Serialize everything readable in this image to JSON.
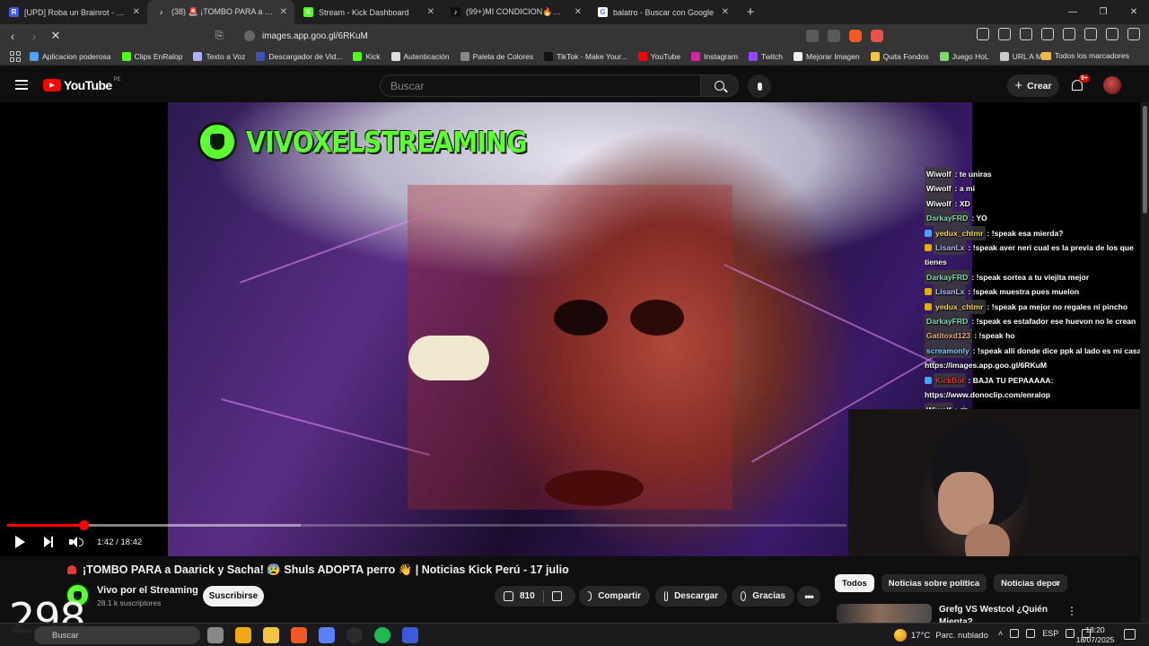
{
  "browser": {
    "tabs": [
      {
        "label": "[UPD] Roba un Brainrot - Roblox",
        "color": "#3b5bdb",
        "glyph": "R"
      },
      {
        "label": "(38) 🚨 ¡TOMBO PARA a Daarick",
        "color": "#353535",
        "glyph": "♪",
        "active": true
      },
      {
        "label": "Stream - Kick Dashboard",
        "color": "#53fc18",
        "glyph": "K"
      },
      {
        "label": "(99+)MI CONDICION🔥🔥 #fyp #",
        "color": "#111111",
        "glyph": "♪"
      },
      {
        "label": "balatro - Buscar con Google",
        "color": "#ffffff",
        "glyph": "G"
      }
    ],
    "url": "images.app.goo.gl/6RKuM",
    "bookmarks": [
      {
        "label": "Aplicacion poderosa",
        "color": "#4aa3ff"
      },
      {
        "label": "Clips EnRalop",
        "color": "#53fc18"
      },
      {
        "label": "Texto a Voz",
        "color": "#b0b0ff"
      },
      {
        "label": "Descargador de Vid...",
        "color": "#3f51b5"
      },
      {
        "label": "Kick",
        "color": "#53fc18"
      },
      {
        "label": "Autenticación",
        "color": "#dddddd"
      },
      {
        "label": "Paleta de Colores",
        "color": "#888888"
      },
      {
        "label": "TikTok - Make Your...",
        "color": "#111111"
      },
      {
        "label": "YouTube",
        "color": "#ff0000"
      },
      {
        "label": "Instagram",
        "color": "#d6249f"
      },
      {
        "label": "Twitch",
        "color": "#9146ff"
      },
      {
        "label": "Mejorar Imagen",
        "color": "#eeeeee"
      },
      {
        "label": "Quita Fondos",
        "color": "#f5c542"
      },
      {
        "label": "Juego HoL",
        "color": "#7bd86b"
      },
      {
        "label": "URL A MP3",
        "color": "#cccccc"
      }
    ],
    "all_bookmarks": "Todos los marcadores"
  },
  "youtube": {
    "logo_word": "YouTube",
    "country": "PE",
    "search_placeholder": "Buscar",
    "create_label": "Crear",
    "notif_count": "9+"
  },
  "video": {
    "watermark": "VIVOXELSTREAMING",
    "current_time": "1:42",
    "duration": "18:42",
    "time_display": "1:42 / 18:42",
    "progress_fraction": 0.0909,
    "buffer_fraction": 0.35
  },
  "chat": [
    {
      "user": "Wiwolf",
      "user_color": "#ffffff",
      "badge": null,
      "text": ": te uniras"
    },
    {
      "user": "Wiwolf",
      "user_color": "#ffffff",
      "badge": null,
      "text": ": a mi"
    },
    {
      "user": "Wiwolf",
      "user_color": "#ffffff",
      "badge": null,
      "text": ": XD"
    },
    {
      "user": "DarkayFRD",
      "user_color": "#7be3b0",
      "badge": null,
      "text": ": YO"
    },
    {
      "user": "yedux_chtmr",
      "user_color": "#f5d742",
      "badge": "#4aa3ff",
      "text": ": !speak esa mierda?"
    },
    {
      "user": "LisanLx",
      "user_color": "#b7b7ff",
      "badge": "#e0b000",
      "text": ": !speak aver neri cual es la previa de los que tienes"
    },
    {
      "user": "DarkayFRD",
      "user_color": "#7be3b0",
      "badge": null,
      "text": ": !speak sortea a tu viejita mejor"
    },
    {
      "user": "LisanLx",
      "user_color": "#b7b7ff",
      "badge": "#e0b000",
      "text": ": !speak muestra pues muelon"
    },
    {
      "user": "yedux_chtmr",
      "user_color": "#f5d742",
      "badge": "#e0b000",
      "text": ": !speak pa mejor no regales ni pincho"
    },
    {
      "user": "DarkayFRD",
      "user_color": "#7be3b0",
      "badge": null,
      "text": ": !speak es estafador ese huevon no le crean"
    },
    {
      "user": "Gatitoxd123",
      "user_color": "#f0b070",
      "badge": null,
      "text": ": !speak ho"
    },
    {
      "user": "screamonly",
      "user_color": "#7fd0ff",
      "badge": null,
      "text": ": !speak allí donde dice ppk al lado es mi casa https://images.app.goo.gl/6RKuM"
    },
    {
      "user": "KickBot",
      "user_color": "#e53935",
      "badge": "#4aa3ff",
      "text": ": BAJA TU PEPAAAAA: https://www.donoclip.com/enralop"
    },
    {
      "user": "Wiwolf",
      "user_color": "#ffffff",
      "badge": null,
      "text": ": 🤖"
    }
  ],
  "details": {
    "title": "¡TOMBO PARA a Daarick y Sacha! 😰 Shuls ADOPTA perro 👋 | Noticias Kick Perú - 17 julio",
    "channel_name": "Vivo por el Streaming",
    "subscribers": "28.1 k suscriptores",
    "subscribe_label": "Suscribirse",
    "likes": "810",
    "share_label": "Compartir",
    "download_label": "Descargar",
    "thanks_label": "Gracias"
  },
  "sidebar": {
    "chips": [
      {
        "label": "Todos",
        "active": true
      },
      {
        "label": "Noticias sobre política",
        "active": false
      },
      {
        "label": "Noticias depor",
        "active": false
      }
    ],
    "rec_title": "Grefg VS Westcol ¿Quién Mienta?"
  },
  "overlay_counter": "298",
  "taskbar": {
    "search_label": "Buscar",
    "temperature": "17°C",
    "weather_text": "Parc. nublado",
    "lang": "ESP",
    "time": "18:20",
    "date": "18/07/2025",
    "icon_colors": [
      "#888888",
      "#f3a712",
      "#f5c542",
      "#f15a24",
      "#5a7fff",
      "#2b2b2b",
      "#1db954",
      "#3b5bdb"
    ]
  }
}
